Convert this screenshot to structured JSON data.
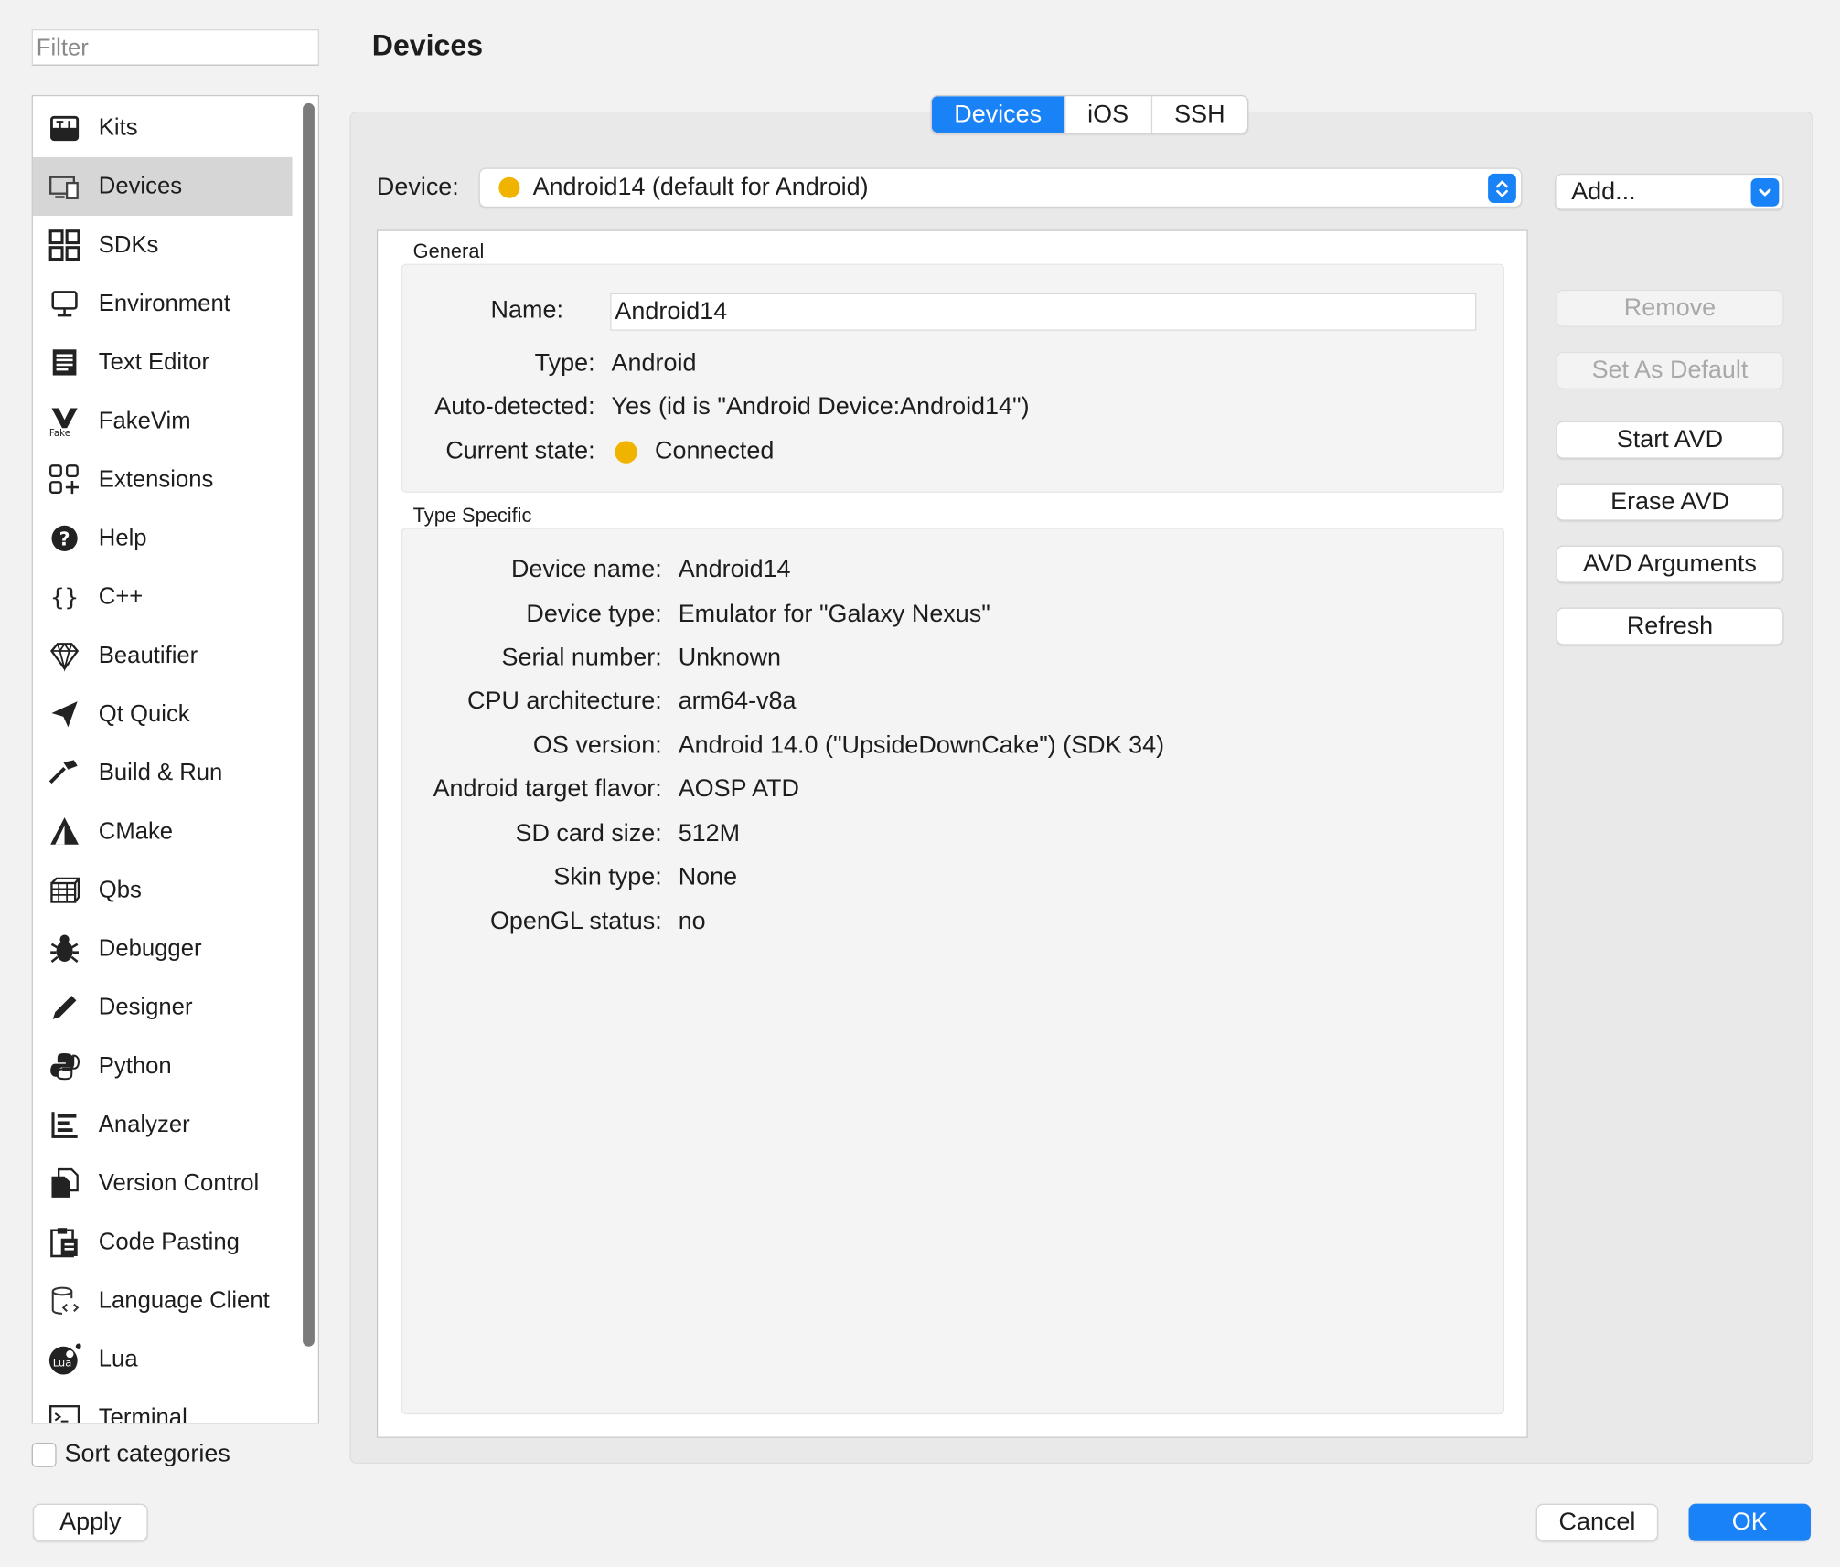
{
  "page": {
    "title": "Devices"
  },
  "filter": {
    "placeholder": "Filter"
  },
  "sidebar": {
    "items": [
      {
        "label": "Kits",
        "icon": "kits-icon"
      },
      {
        "label": "Devices",
        "icon": "devices-icon",
        "selected": true
      },
      {
        "label": "SDKs",
        "icon": "sdks-icon"
      },
      {
        "label": "Environment",
        "icon": "environment-icon"
      },
      {
        "label": "Text Editor",
        "icon": "text-editor-icon"
      },
      {
        "label": "FakeVim",
        "icon": "fakevim-icon"
      },
      {
        "label": "Extensions",
        "icon": "extensions-icon"
      },
      {
        "label": "Help",
        "icon": "help-icon"
      },
      {
        "label": "C++",
        "icon": "cpp-icon"
      },
      {
        "label": "Beautifier",
        "icon": "beautifier-icon"
      },
      {
        "label": "Qt Quick",
        "icon": "qt-quick-icon"
      },
      {
        "label": "Build & Run",
        "icon": "build-run-icon"
      },
      {
        "label": "CMake",
        "icon": "cmake-icon"
      },
      {
        "label": "Qbs",
        "icon": "qbs-icon"
      },
      {
        "label": "Debugger",
        "icon": "debugger-icon"
      },
      {
        "label": "Designer",
        "icon": "designer-icon"
      },
      {
        "label": "Python",
        "icon": "python-icon"
      },
      {
        "label": "Analyzer",
        "icon": "analyzer-icon"
      },
      {
        "label": "Version Control",
        "icon": "version-control-icon"
      },
      {
        "label": "Code Pasting",
        "icon": "code-pasting-icon"
      },
      {
        "label": "Language Client",
        "icon": "language-client-icon"
      },
      {
        "label": "Lua",
        "icon": "lua-icon"
      },
      {
        "label": "Terminal",
        "icon": "terminal-icon"
      }
    ],
    "sort_label": "Sort categories"
  },
  "tabs": [
    {
      "label": "Devices",
      "active": true
    },
    {
      "label": "iOS",
      "active": false
    },
    {
      "label": "SSH",
      "active": false
    }
  ],
  "device": {
    "label": "Device:",
    "selected": "Android14 (default for Android)",
    "status_color": "#f0b400"
  },
  "actions": {
    "add": "Add...",
    "remove": "Remove",
    "set_default": "Set As Default",
    "start_avd": "Start AVD",
    "erase_avd": "Erase AVD",
    "avd_arguments": "AVD Arguments",
    "refresh": "Refresh"
  },
  "general": {
    "title": "General",
    "name_label": "Name:",
    "name_value": "Android14",
    "type_label": "Type:",
    "type_value": "Android",
    "auto_label": "Auto-detected:",
    "auto_value": "Yes (id is \"Android Device:Android14\")",
    "state_label": "Current state:",
    "state_value": "Connected"
  },
  "type_specific": {
    "title": "Type Specific",
    "rows": [
      {
        "label": "Device name:",
        "value": "Android14"
      },
      {
        "label": "Device type:",
        "value": "Emulator for \"Galaxy Nexus\""
      },
      {
        "label": "Serial number:",
        "value": "Unknown"
      },
      {
        "label": "CPU architecture:",
        "value": "arm64-v8a"
      },
      {
        "label": "OS version:",
        "value": "Android 14.0 (\"UpsideDownCake\") (SDK 34)"
      },
      {
        "label": "Android target flavor:",
        "value": "AOSP ATD"
      },
      {
        "label": "SD card size:",
        "value": "512M"
      },
      {
        "label": "Skin type:",
        "value": "None"
      },
      {
        "label": "OpenGL status:",
        "value": "no"
      }
    ]
  },
  "footer": {
    "apply": "Apply",
    "cancel": "Cancel",
    "ok": "OK"
  },
  "colors": {
    "accent": "#1a82f7",
    "status_connected": "#f0b400",
    "selected_row": "#d6d6d6"
  }
}
